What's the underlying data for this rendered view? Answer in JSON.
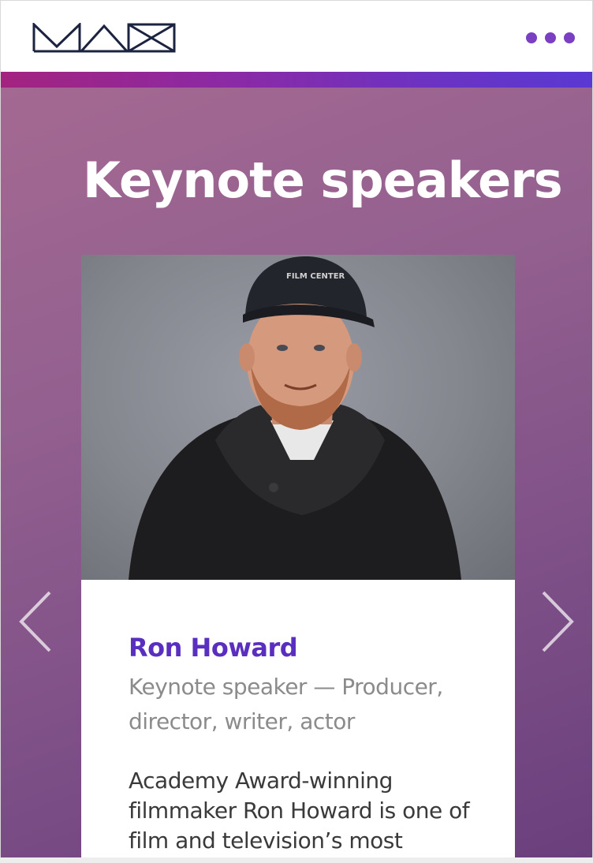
{
  "header": {
    "logo_icon": "max-logo-icon",
    "menu_icon": "more-dots-icon",
    "menu_color": "#7b3fc2"
  },
  "hero": {
    "title": "Keynote speakers",
    "prev_icon": "chevron-left-icon",
    "next_icon": "chevron-right-icon"
  },
  "speaker": {
    "name": "Ron Howard",
    "role": "Keynote speaker — Producer, director, writer, actor",
    "bio": "Academy Award-winning filmmaker Ron Howard is one of film and television’s most"
  },
  "colors": {
    "accent_start": "#a3237f",
    "accent_end": "#5a39d2",
    "name_color": "#5a2fc0"
  }
}
